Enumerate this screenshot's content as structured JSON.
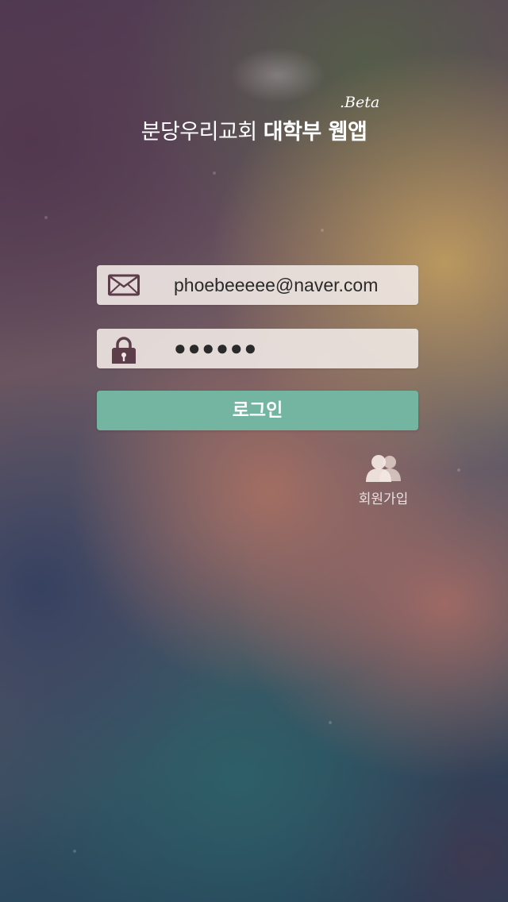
{
  "header": {
    "title_regular": "분당우리교회 ",
    "title_bold": "대학부  웹앱",
    "beta_tag": ".Beta"
  },
  "login_form": {
    "email": {
      "value": "phoebeeeee@naver.com",
      "icon": "envelope-icon"
    },
    "password": {
      "masked_value": "●●●●●●",
      "icon": "lock-icon"
    },
    "login_button_label": "로그인"
  },
  "signup": {
    "label": "회원가입",
    "icon": "users-icon"
  },
  "colors": {
    "button": "#73b5a0",
    "icon": "#5e3d4b",
    "field_background": "#efe7e3"
  }
}
